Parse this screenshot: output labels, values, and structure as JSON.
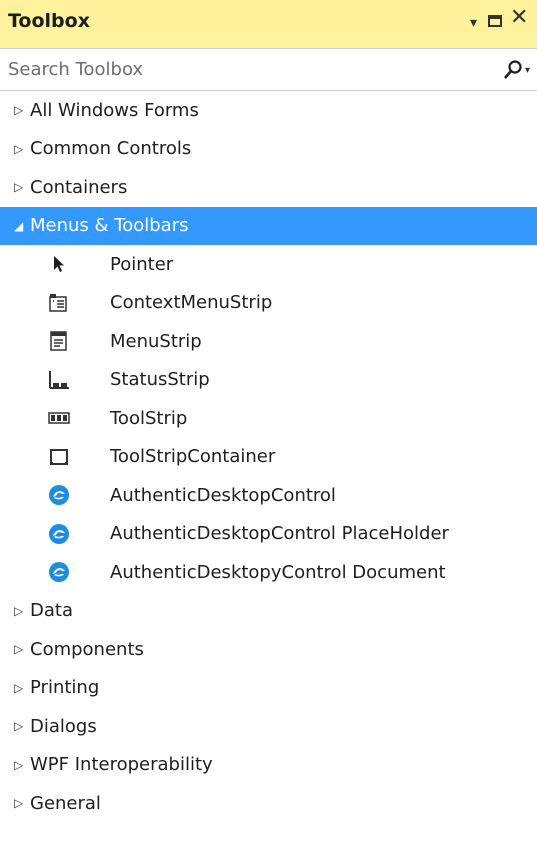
{
  "window": {
    "title": "Toolbox",
    "dropdown_glyph": "▾",
    "close_glyph": "✕"
  },
  "search": {
    "placeholder": "Search Toolbox",
    "value": "",
    "dropdown_glyph": "▾"
  },
  "categories_before": [
    {
      "label": "All Windows Forms",
      "arrow": "▷"
    },
    {
      "label": "Common Controls",
      "arrow": "▷"
    },
    {
      "label": "Containers",
      "arrow": "▷"
    }
  ],
  "open_category": {
    "label": "Menus & Toolbars",
    "arrow": "◢",
    "items": [
      {
        "label": "Pointer",
        "icon": "pointer-icon"
      },
      {
        "label": "ContextMenuStrip",
        "icon": "context-menu-strip-icon"
      },
      {
        "label": "MenuStrip",
        "icon": "menu-strip-icon"
      },
      {
        "label": "StatusStrip",
        "icon": "status-strip-icon"
      },
      {
        "label": "ToolStrip",
        "icon": "tool-strip-icon"
      },
      {
        "label": "ToolStripContainer",
        "icon": "tool-strip-container-icon"
      },
      {
        "label": "AuthenticDesktopControl",
        "icon": "authentic-icon"
      },
      {
        "label": "AuthenticDesktopControl PlaceHolder",
        "icon": "authentic-icon"
      },
      {
        "label": "AuthenticDesktopyControl Document",
        "icon": "authentic-icon"
      }
    ]
  },
  "categories_after": [
    {
      "label": "Data",
      "arrow": "▷"
    },
    {
      "label": "Components",
      "arrow": "▷"
    },
    {
      "label": "Printing",
      "arrow": "▷"
    },
    {
      "label": "Dialogs",
      "arrow": "▷"
    },
    {
      "label": "WPF Interoperability",
      "arrow": "▷"
    },
    {
      "label": "General",
      "arrow": "▷"
    }
  ],
  "colors": {
    "titlebar_bg": "#fff29d",
    "selected_bg": "#3399ff",
    "authentic_icon": "#1e8de0"
  }
}
